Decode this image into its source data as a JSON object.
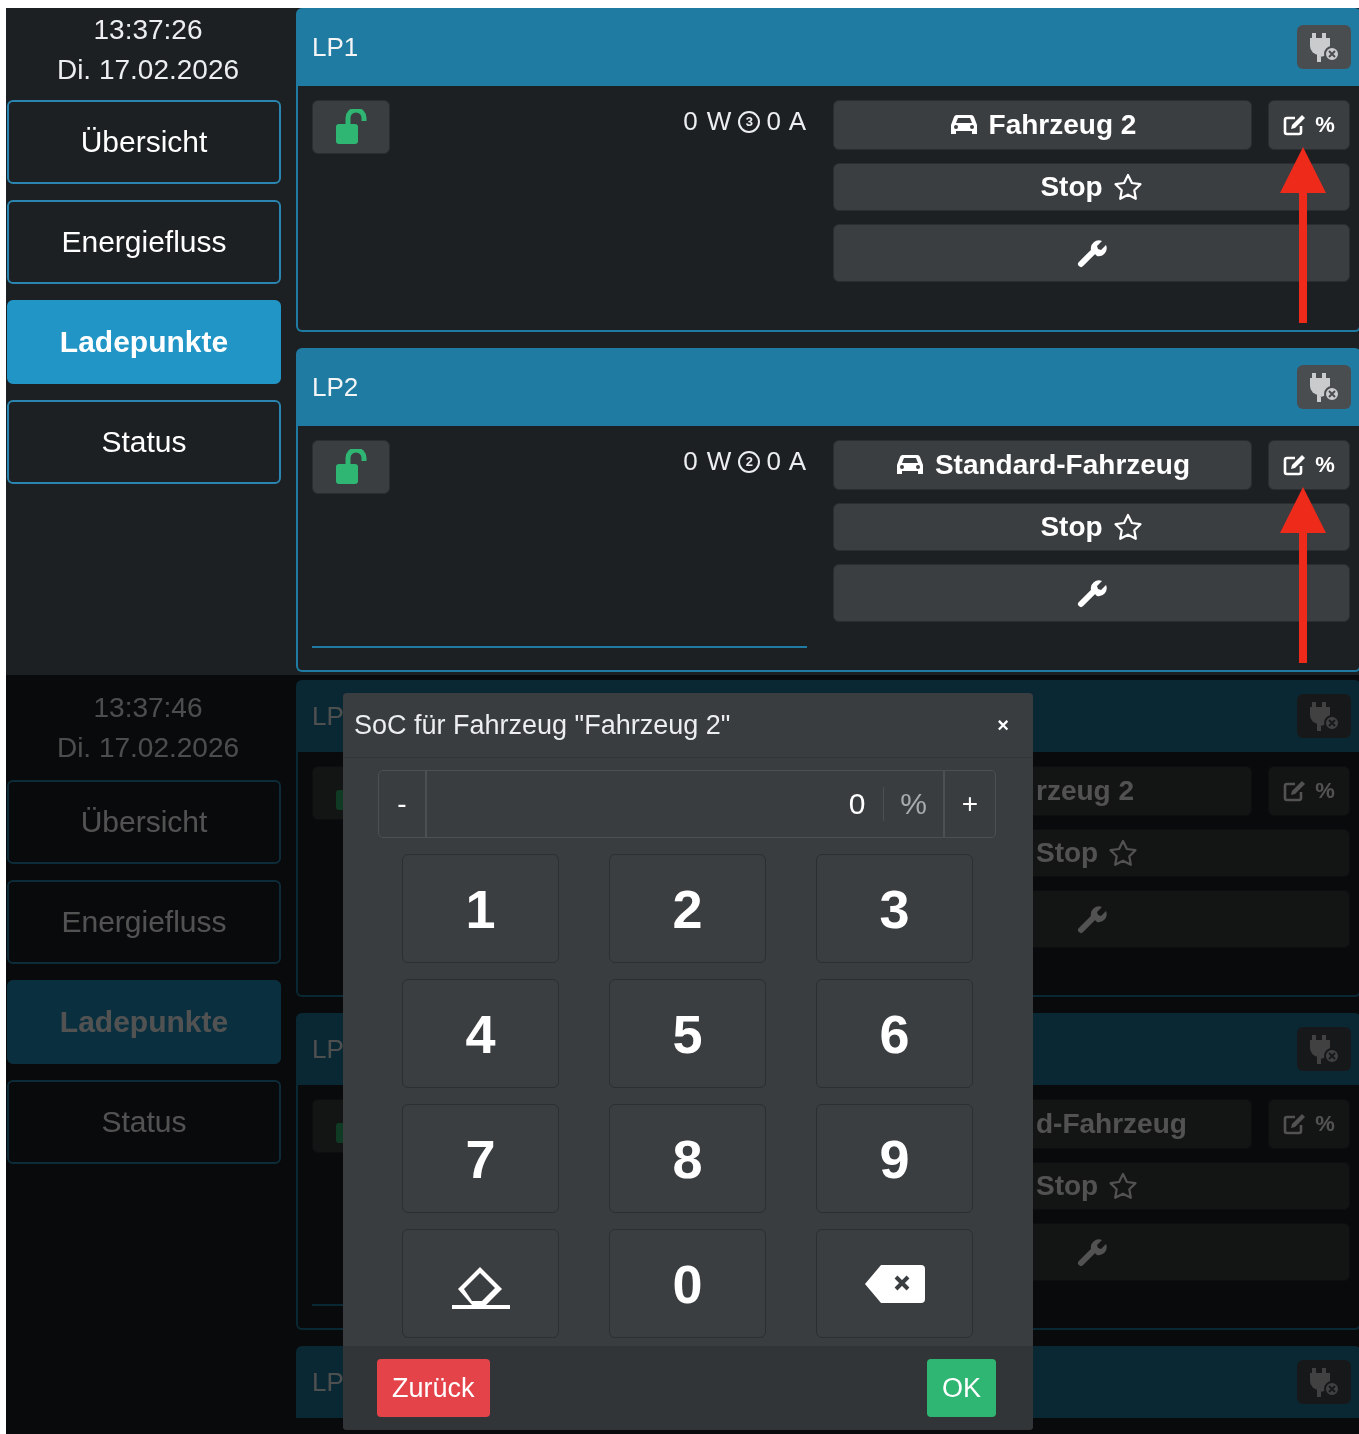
{
  "screens": [
    {
      "clock": {
        "time": "13:37:26",
        "date": "Di. 17.02.2026"
      },
      "nav": [
        {
          "label": "Übersicht",
          "selected": false
        },
        {
          "label": "Energiefluss",
          "selected": false
        },
        {
          "label": "Ladepunkte",
          "selected": true
        },
        {
          "label": "Status",
          "selected": false
        }
      ],
      "charge_points": [
        {
          "title": "LP1",
          "locked": false,
          "power": "0 W",
          "phases": "3",
          "current": "0 A",
          "vehicle": "Fahrzeug 2",
          "soc_button": "%",
          "mode": "Stop",
          "highlighted": true
        },
        {
          "title": "LP2",
          "locked": false,
          "power": "0 W",
          "phases": "2",
          "current": "0 A",
          "vehicle": "Standard-Fahrzeug",
          "soc_button": "%",
          "mode": "Stop",
          "highlighted": true,
          "progress": {
            "level": 0
          }
        }
      ]
    },
    {
      "clock": {
        "time": "13:37:46",
        "date": "Di. 17.02.2026"
      },
      "nav": [
        {
          "label": "Übersicht",
          "selected": false
        },
        {
          "label": "Energiefluss",
          "selected": false
        },
        {
          "label": "Ladepunkte",
          "selected": true
        },
        {
          "label": "Status",
          "selected": false
        }
      ],
      "charge_points": [
        {
          "title": "LP",
          "locked": false,
          "vehicle": "rzeug 2",
          "soc_button": "%",
          "mode": "Stop"
        },
        {
          "title": "LP",
          "locked": false,
          "vehicle": "d-Fahrzeug",
          "soc_button": "%",
          "mode": "Stop",
          "progress": {
            "level": 0
          }
        },
        {
          "title": "LP"
        }
      ],
      "modal": {
        "title": "SoC für Fahrzeug \"Fahrzeug 2\"",
        "close": "×",
        "minus": "-",
        "value": "0",
        "unit": "%",
        "plus": "+",
        "keys": [
          {
            "kind": "digit",
            "label": "1"
          },
          {
            "kind": "digit",
            "label": "2"
          },
          {
            "kind": "digit",
            "label": "3"
          },
          {
            "kind": "digit",
            "label": "4"
          },
          {
            "kind": "digit",
            "label": "5"
          },
          {
            "kind": "digit",
            "label": "6"
          },
          {
            "kind": "digit",
            "label": "7"
          },
          {
            "kind": "digit",
            "label": "8"
          },
          {
            "kind": "digit",
            "label": "9"
          },
          {
            "kind": "clear"
          },
          {
            "kind": "digit",
            "label": "0"
          },
          {
            "kind": "backspace"
          }
        ],
        "buttons": [
          {
            "kind": "cancel",
            "label": "Zurück"
          },
          {
            "kind": "confirm",
            "label": "OK"
          }
        ]
      }
    }
  ]
}
